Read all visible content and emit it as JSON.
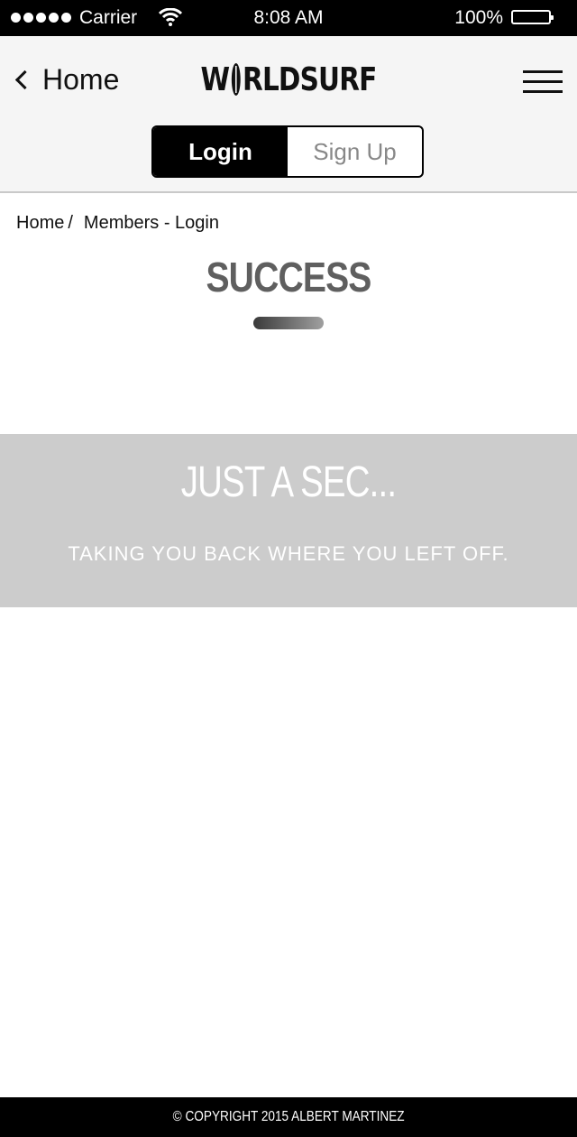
{
  "status_bar": {
    "carrier": "Carrier",
    "time": "8:08 AM",
    "battery": "100%"
  },
  "header": {
    "back_label": "Home",
    "logo_prefix": "W",
    "logo_suffix": "RLDSURF",
    "tabs": [
      {
        "label": "Login",
        "active": true
      },
      {
        "label": "Sign Up",
        "active": false
      }
    ]
  },
  "breadcrumb": {
    "home": "Home",
    "separator": "/",
    "current": "Members - Login"
  },
  "page": {
    "title": "SUCCESS"
  },
  "banner": {
    "title": "JUST A SEC...",
    "message": "TAKING YOU BACK WHERE YOU LEFT OFF."
  },
  "footer": {
    "copyright": "© COPYRIGHT 2015 ALBERT MARTINEZ"
  },
  "icons": [
    "signal-dots-icon",
    "wifi-icon",
    "battery-icon",
    "chevron-left-icon",
    "hamburger-menu-icon"
  ]
}
